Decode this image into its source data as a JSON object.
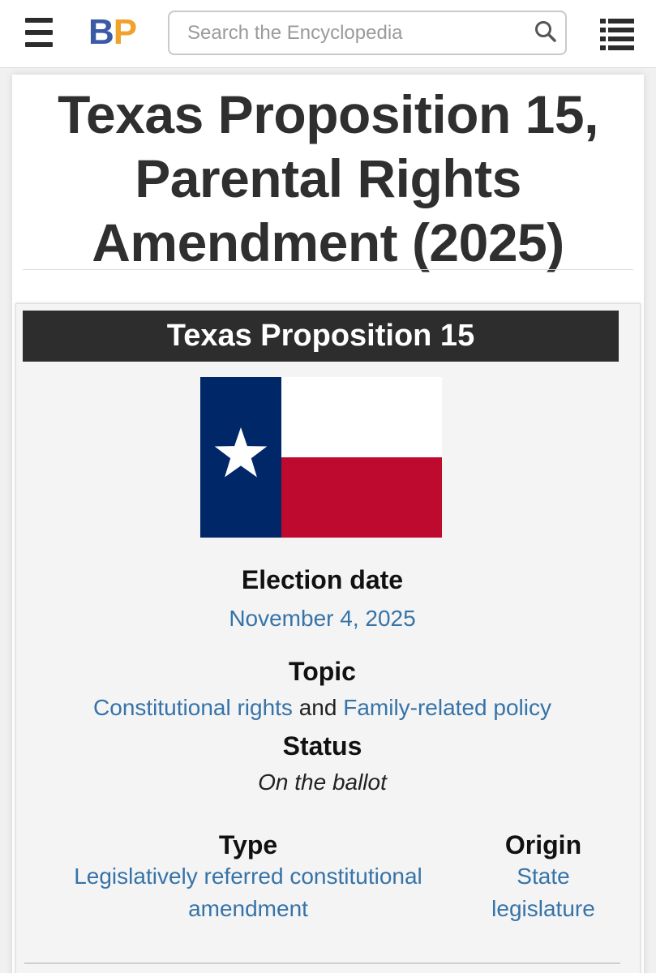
{
  "header": {
    "logo_b": "B",
    "logo_p": "P",
    "search_placeholder": "Search the Encyclopedia"
  },
  "page": {
    "title_line1": "Texas Proposition 15,",
    "title_line2": "Parental Rights",
    "title_line3": "Amendment (2025)"
  },
  "infobox": {
    "heading": "Texas Proposition 15",
    "election_date_label": "Election date",
    "election_date": "November 4, 2025",
    "topic_label": "Topic",
    "topic_link1": "Constitutional rights",
    "topic_and": "and",
    "topic_link2": "Family-related policy",
    "status_label": "Status",
    "status": "On the ballot",
    "type_label": "Type",
    "type_line1": "Legislatively referred constitutional",
    "type_line2": "amendment",
    "origin_label": "Origin",
    "origin_line1": "State",
    "origin_line2": "legislature"
  },
  "icons": {
    "menu": "hamburger-menu-icon",
    "search": "magnifier-icon",
    "contents": "table-of-contents-icon",
    "flag": "texas-flag"
  },
  "colors": {
    "logo_blue": "#3b5aa6",
    "logo_orange": "#f0a32c",
    "link": "#3673a8",
    "flag_blue": "#002868",
    "flag_red": "#bf0a30",
    "header_bar": "#2d2d2d"
  }
}
